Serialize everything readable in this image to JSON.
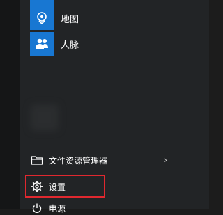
{
  "start_menu": {
    "apps": [
      {
        "label": "",
        "icon": "app-tile-icon"
      },
      {
        "label": "地图",
        "icon": "map-pin-icon"
      },
      {
        "label": "人脉",
        "icon": "people-icon"
      }
    ],
    "system": {
      "file_explorer_label": "文件资源管理器",
      "settings_label": "设置",
      "power_label": "电源"
    }
  },
  "colors": {
    "tile_blue": "#1877d2",
    "highlight_red": "#e0282f",
    "menu_bg": "#222426"
  }
}
